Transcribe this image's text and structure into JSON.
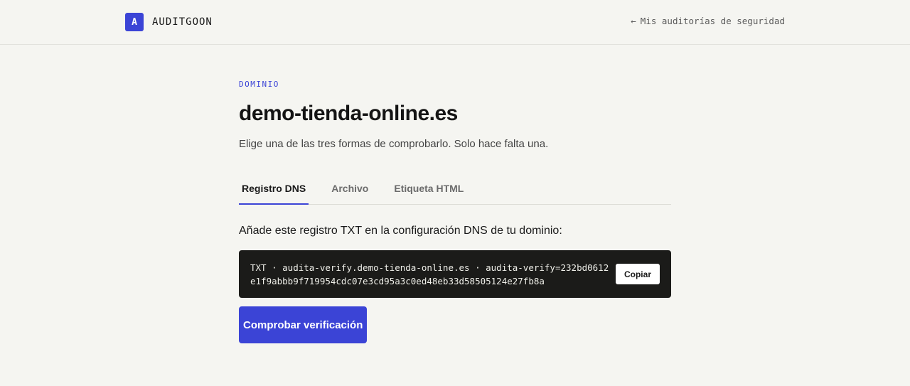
{
  "header": {
    "logo_letter": "A",
    "brand_name": "AUDITGOON",
    "back_arrow": "←",
    "back_label": "Mis auditorías de seguridad"
  },
  "main": {
    "eyebrow": "DOMINIO",
    "domain": "demo-tienda-online.es",
    "subtitle": "Elige una de las tres formas de comprobarlo. Solo hace falta una.",
    "tabs": [
      {
        "label": "Registro DNS",
        "active": true
      },
      {
        "label": "Archivo",
        "active": false
      },
      {
        "label": "Etiqueta HTML",
        "active": false
      }
    ],
    "instruction": "Añade este registro TXT en la configuración DNS de tu dominio:",
    "record": "TXT · audita-verify.demo-tienda-online.es · audita-verify=232bd0612e1f9abbb9f719954cdc07e3cd95a3c0ed48eb33d58505124e27fb8a",
    "copy_label": "Copiar",
    "verify_label": "Comprobar verificación"
  },
  "colors": {
    "accent": "#3b44d6",
    "background": "#f5f5f1",
    "code_background": "#1b1b19"
  }
}
